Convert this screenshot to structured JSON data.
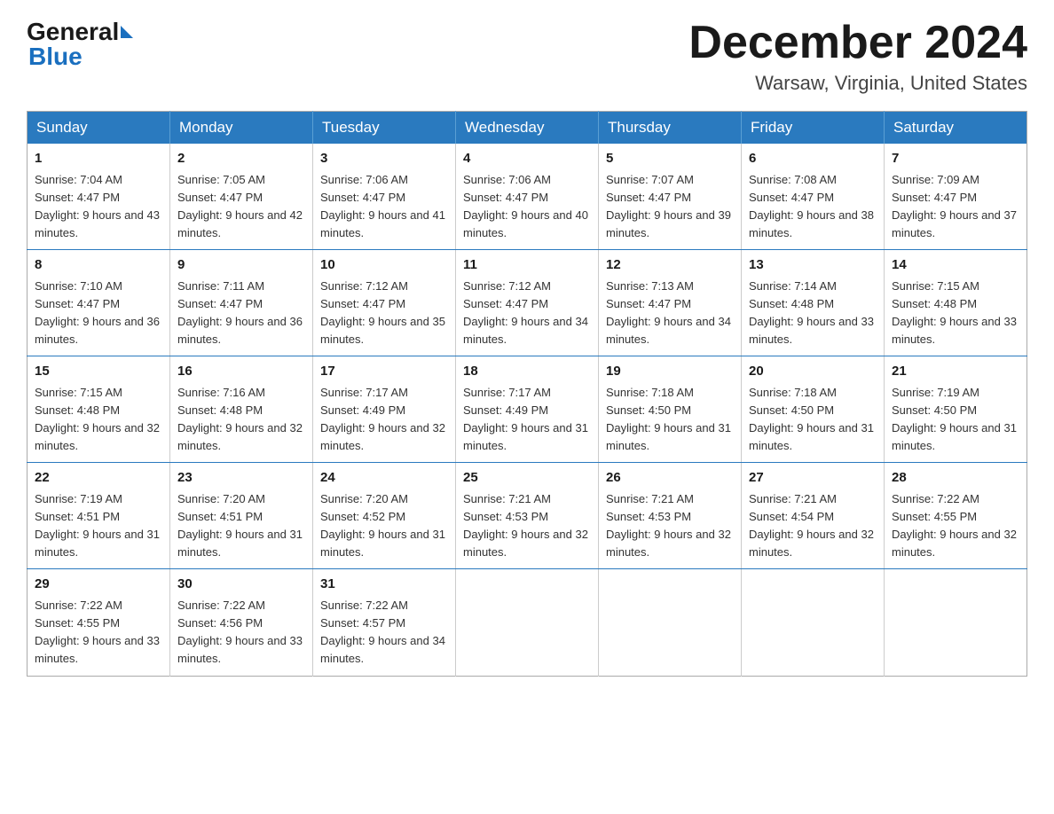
{
  "header": {
    "logo_general": "General",
    "logo_blue": "Blue",
    "month_title": "December 2024",
    "location": "Warsaw, Virginia, United States"
  },
  "weekdays": [
    "Sunday",
    "Monday",
    "Tuesday",
    "Wednesday",
    "Thursday",
    "Friday",
    "Saturday"
  ],
  "weeks": [
    [
      {
        "day": "1",
        "sunrise": "7:04 AM",
        "sunset": "4:47 PM",
        "daylight": "9 hours and 43 minutes."
      },
      {
        "day": "2",
        "sunrise": "7:05 AM",
        "sunset": "4:47 PM",
        "daylight": "9 hours and 42 minutes."
      },
      {
        "day": "3",
        "sunrise": "7:06 AM",
        "sunset": "4:47 PM",
        "daylight": "9 hours and 41 minutes."
      },
      {
        "day": "4",
        "sunrise": "7:06 AM",
        "sunset": "4:47 PM",
        "daylight": "9 hours and 40 minutes."
      },
      {
        "day": "5",
        "sunrise": "7:07 AM",
        "sunset": "4:47 PM",
        "daylight": "9 hours and 39 minutes."
      },
      {
        "day": "6",
        "sunrise": "7:08 AM",
        "sunset": "4:47 PM",
        "daylight": "9 hours and 38 minutes."
      },
      {
        "day": "7",
        "sunrise": "7:09 AM",
        "sunset": "4:47 PM",
        "daylight": "9 hours and 37 minutes."
      }
    ],
    [
      {
        "day": "8",
        "sunrise": "7:10 AM",
        "sunset": "4:47 PM",
        "daylight": "9 hours and 36 minutes."
      },
      {
        "day": "9",
        "sunrise": "7:11 AM",
        "sunset": "4:47 PM",
        "daylight": "9 hours and 36 minutes."
      },
      {
        "day": "10",
        "sunrise": "7:12 AM",
        "sunset": "4:47 PM",
        "daylight": "9 hours and 35 minutes."
      },
      {
        "day": "11",
        "sunrise": "7:12 AM",
        "sunset": "4:47 PM",
        "daylight": "9 hours and 34 minutes."
      },
      {
        "day": "12",
        "sunrise": "7:13 AM",
        "sunset": "4:47 PM",
        "daylight": "9 hours and 34 minutes."
      },
      {
        "day": "13",
        "sunrise": "7:14 AM",
        "sunset": "4:48 PM",
        "daylight": "9 hours and 33 minutes."
      },
      {
        "day": "14",
        "sunrise": "7:15 AM",
        "sunset": "4:48 PM",
        "daylight": "9 hours and 33 minutes."
      }
    ],
    [
      {
        "day": "15",
        "sunrise": "7:15 AM",
        "sunset": "4:48 PM",
        "daylight": "9 hours and 32 minutes."
      },
      {
        "day": "16",
        "sunrise": "7:16 AM",
        "sunset": "4:48 PM",
        "daylight": "9 hours and 32 minutes."
      },
      {
        "day": "17",
        "sunrise": "7:17 AM",
        "sunset": "4:49 PM",
        "daylight": "9 hours and 32 minutes."
      },
      {
        "day": "18",
        "sunrise": "7:17 AM",
        "sunset": "4:49 PM",
        "daylight": "9 hours and 31 minutes."
      },
      {
        "day": "19",
        "sunrise": "7:18 AM",
        "sunset": "4:50 PM",
        "daylight": "9 hours and 31 minutes."
      },
      {
        "day": "20",
        "sunrise": "7:18 AM",
        "sunset": "4:50 PM",
        "daylight": "9 hours and 31 minutes."
      },
      {
        "day": "21",
        "sunrise": "7:19 AM",
        "sunset": "4:50 PM",
        "daylight": "9 hours and 31 minutes."
      }
    ],
    [
      {
        "day": "22",
        "sunrise": "7:19 AM",
        "sunset": "4:51 PM",
        "daylight": "9 hours and 31 minutes."
      },
      {
        "day": "23",
        "sunrise": "7:20 AM",
        "sunset": "4:51 PM",
        "daylight": "9 hours and 31 minutes."
      },
      {
        "day": "24",
        "sunrise": "7:20 AM",
        "sunset": "4:52 PM",
        "daylight": "9 hours and 31 minutes."
      },
      {
        "day": "25",
        "sunrise": "7:21 AM",
        "sunset": "4:53 PM",
        "daylight": "9 hours and 32 minutes."
      },
      {
        "day": "26",
        "sunrise": "7:21 AM",
        "sunset": "4:53 PM",
        "daylight": "9 hours and 32 minutes."
      },
      {
        "day": "27",
        "sunrise": "7:21 AM",
        "sunset": "4:54 PM",
        "daylight": "9 hours and 32 minutes."
      },
      {
        "day": "28",
        "sunrise": "7:22 AM",
        "sunset": "4:55 PM",
        "daylight": "9 hours and 32 minutes."
      }
    ],
    [
      {
        "day": "29",
        "sunrise": "7:22 AM",
        "sunset": "4:55 PM",
        "daylight": "9 hours and 33 minutes."
      },
      {
        "day": "30",
        "sunrise": "7:22 AM",
        "sunset": "4:56 PM",
        "daylight": "9 hours and 33 minutes."
      },
      {
        "day": "31",
        "sunrise": "7:22 AM",
        "sunset": "4:57 PM",
        "daylight": "9 hours and 34 minutes."
      },
      null,
      null,
      null,
      null
    ]
  ],
  "labels": {
    "sunrise_prefix": "Sunrise: ",
    "sunset_prefix": "Sunset: ",
    "daylight_prefix": "Daylight: "
  }
}
